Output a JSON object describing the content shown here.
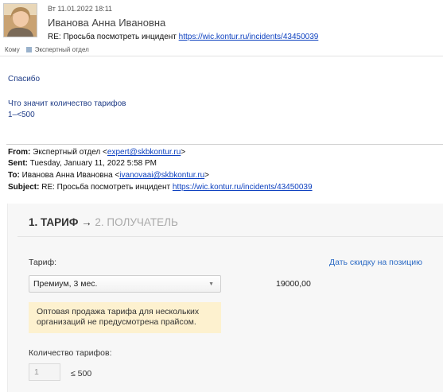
{
  "header": {
    "date": "Вт 11.01.2022 18:11",
    "sender": "Иванова Анна Ивановна",
    "subject_prefix": "RE: Просьба посмотреть инцидент",
    "subject_link": "https://wic.kontur.ru/incidents/43450039",
    "to_label": "Кому",
    "to_value": "Экспертный отдел"
  },
  "body": {
    "line1": "Спасибо",
    "line2": "Что значит количество тарифов",
    "line3": "1–<500"
  },
  "quoted": {
    "from_label": "From:",
    "from_name": "Экспертный отдел <",
    "from_email": "expert@skbkontur.ru",
    "from_tail": ">",
    "sent_label": "Sent:",
    "sent_value": "Tuesday, January 11, 2022 5:58 PM",
    "to_label": "To:",
    "to_name": "Иванова Анна Ивановна <",
    "to_email": "ivanovaai@skbkontur.ru",
    "to_tail": ">",
    "subject_label": "Subject:",
    "subject_prefix": "RE: Просьба посмотреть инцидент",
    "subject_link": "https://wic.kontur.ru/incidents/43450039"
  },
  "card": {
    "step1": "1. ТАРИФ",
    "arrow": "→",
    "step2": "2. ПОЛУЧАТЕЛЬ",
    "tariff_label": "Тариф:",
    "discount_link": "Дать скидку на позицию",
    "tariff_selected": "Премиум, 3 мес.",
    "price": "19000,00",
    "warning_line1": "Оптовая продажа тарифа для нескольких",
    "warning_line2": "организаций не предусмотрена прайсом.",
    "qty_label": "Количество тарифов:",
    "qty_value": "1",
    "qty_limit": "≤ 500"
  },
  "colors": {
    "link": "#0b3fbf",
    "reply_text": "#1f3c87",
    "card_link": "#2e6cc5",
    "warning_bg": "#fdf1cf"
  }
}
